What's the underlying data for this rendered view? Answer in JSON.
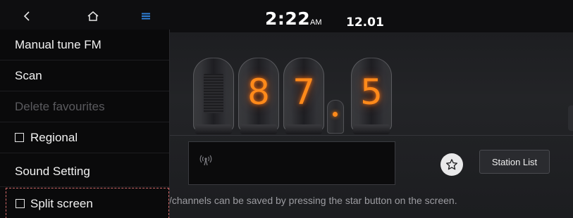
{
  "status_bar": {
    "back_icon": "chevron-left-icon",
    "home_icon": "home-icon",
    "menu_icon": "menu-icon",
    "menu_icon_color": "#2f7fd6",
    "time": "2:22",
    "ampm": "AM",
    "date": "12.01"
  },
  "menu": {
    "items": [
      {
        "label": "Manual tune FM",
        "enabled": true,
        "checkbox": false
      },
      {
        "label": "Scan",
        "enabled": true,
        "checkbox": false
      },
      {
        "label": "Delete favourites",
        "enabled": false,
        "checkbox": false
      },
      {
        "label": "Regional",
        "enabled": true,
        "checkbox": true,
        "checked": false
      },
      {
        "label": "Sound Setting",
        "enabled": true,
        "checkbox": false
      },
      {
        "label": "Split screen",
        "enabled": true,
        "checkbox": true,
        "checked": false,
        "focused": true
      }
    ]
  },
  "radio": {
    "frequency_digits": [
      "",
      "8",
      "7",
      ".",
      "5"
    ],
    "frequency": "87.5",
    "accent_color": "#ff8a1a",
    "signal_icon": "broadcast-signal-icon",
    "favourite_icon": "star-icon",
    "station_list_label": "Station List",
    "hint": "/channels can be saved by pressing the star button on the screen."
  }
}
